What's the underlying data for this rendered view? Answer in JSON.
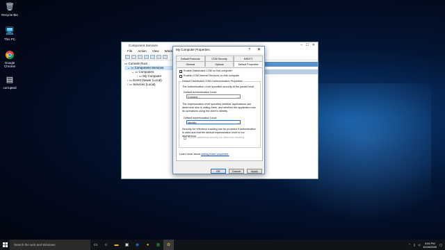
{
  "desktop": {
    "icons": [
      {
        "label": "Recycle Bin",
        "icon": "recycle-bin-icon",
        "glyph": "🗑"
      },
      {
        "label": "This PC",
        "icon": "computer-icon",
        "glyph": "🖥"
      },
      {
        "label": "Google Chrome",
        "icon": "chrome-icon",
        "glyph": "●"
      },
      {
        "label": "corrupted",
        "icon": "text-file-icon",
        "glyph": "▤"
      }
    ]
  },
  "component_services": {
    "title": "Component Services",
    "menu": [
      "File",
      "Action",
      "View",
      "Window",
      "Help"
    ],
    "tree": [
      "Console Root",
      "Component Services",
      "Computers",
      "My Computer",
      "Event Viewer (Local)",
      "Services (Local)"
    ]
  },
  "dialog": {
    "title": "My Computer Properties",
    "help": "?",
    "close": "✕",
    "tabs_row1": [
      "Default Protocols",
      "COM Security",
      "MSDTC"
    ],
    "tabs_row2": [
      "General",
      "Options",
      "Default Properties"
    ],
    "enable_dcom": {
      "label": "Enable Distributed COM on this computer",
      "checked": true,
      "mark": "✓"
    },
    "enable_cis": {
      "label": "Enable COM Internet Services on this computer",
      "checked": false
    },
    "group_title": "Default Distributed COM Communication Properties",
    "auth_desc": "The Authentication Level specifies security at the packet level.",
    "auth_label": "Default Authentication Level:",
    "auth_value": "Connect",
    "imp_desc": "The impersonation level specifies whether applications can determine who is calling them, and whether the application can do operations using the client's identity.",
    "imp_label": "Default Impersonation Level:",
    "imp_value": "Identify",
    "ref_desc": "Security for reference tracking can be provided if authentication is used and that the default impersonation level is not anonymous.",
    "ref_check": "Provide additional security for reference tracking",
    "learn_more": "Learn more about ",
    "learn_link": "setting these properties.",
    "buttons": {
      "ok": "OK",
      "cancel": "Cancel",
      "apply": "Apply"
    }
  },
  "taskbar": {
    "search_placeholder": "Search the web and Windows",
    "time": "3:03 PM",
    "date": "10/16/2020"
  }
}
